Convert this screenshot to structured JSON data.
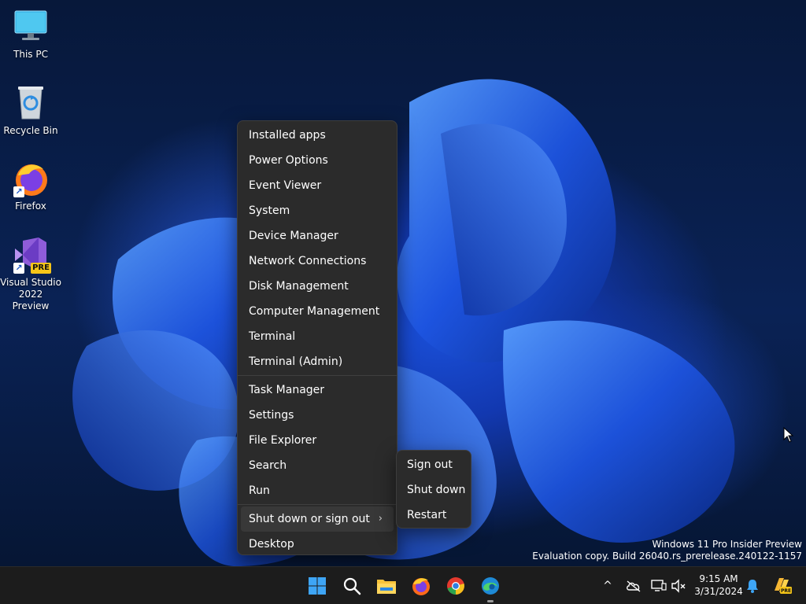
{
  "desktop": {
    "icons": [
      {
        "label": "This PC",
        "icon": "monitor-icon"
      },
      {
        "label": "Recycle Bin",
        "icon": "recycle-bin-icon"
      },
      {
        "label": "Firefox",
        "icon": "firefox-icon"
      },
      {
        "label": "Visual Studio 2022 Preview",
        "icon": "visual-studio-icon",
        "badge": "PRE"
      }
    ]
  },
  "context_menu": {
    "group1": [
      "Installed apps",
      "Power Options",
      "Event Viewer",
      "System",
      "Device Manager",
      "Network Connections",
      "Disk Management",
      "Computer Management",
      "Terminal",
      "Terminal (Admin)"
    ],
    "group2": [
      "Task Manager",
      "Settings",
      "File Explorer",
      "Search",
      "Run"
    ],
    "shutdown_item": "Shut down or sign out",
    "shutdown_chevron": "›",
    "desktop_item": "Desktop"
  },
  "submenu": {
    "items": [
      "Sign out",
      "Shut down",
      "Restart"
    ]
  },
  "watermark": {
    "line1": "Windows 11 Pro Insider Preview",
    "line2": "Evaluation copy. Build 26040.rs_prerelease.240122-1157"
  },
  "taskbar": {
    "apps": [
      "start-icon",
      "search-icon",
      "file-explorer-icon",
      "firefox-icon",
      "chrome-icon",
      "edge-icon"
    ],
    "tray": {
      "overflow_chevron": "^",
      "time": "9:15 AM",
      "date": "3/31/2024"
    }
  },
  "colors": {
    "menu_bg": "#2b2b2b",
    "taskbar_bg": "#1c1c1c",
    "accent": "#0067c0"
  }
}
